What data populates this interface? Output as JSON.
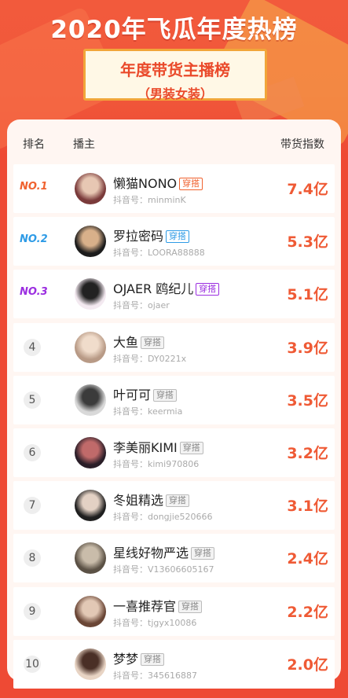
{
  "hero": {
    "title": "2020年飞瓜年度热榜",
    "badge_title": "年度带货主播榜",
    "badge_sub": "（男装女装）"
  },
  "table": {
    "headers": {
      "rank": "排名",
      "host": "播主",
      "index": "带货指数"
    },
    "rows": [
      {
        "rank": "NO.1",
        "name": "懒猫NONO",
        "tag": "穿搭",
        "id_label": "抖音号：",
        "id": "minminK",
        "value": "7.4亿",
        "rank_color": "#f0622f",
        "tag_color": "#f0622f",
        "avatar_colors": [
          "#7a3a3a",
          "#e7c7b3"
        ]
      },
      {
        "rank": "NO.2",
        "name": "罗拉密码",
        "tag": "穿搭",
        "id_label": "抖音号：",
        "id": "LOORA88888",
        "value": "5.3亿",
        "rank_color": "#2e9be6",
        "tag_color": "#2e9be6",
        "avatar_colors": [
          "#1c1c1c",
          "#d8b08a"
        ]
      },
      {
        "rank": "NO.3",
        "name": "OJAER 鸥纪儿",
        "tag": "穿搭",
        "id_label": "抖音号：",
        "id": "ojaer",
        "value": "5.1亿",
        "rank_color": "#9b2ee0",
        "tag_color": "#9b2ee0",
        "avatar_colors": [
          "#f3e9f0",
          "#222222"
        ]
      },
      {
        "rank": "4",
        "name": "大鱼",
        "tag": "穿搭",
        "id_label": "抖音号：",
        "id": "DY0221x",
        "value": "3.9亿",
        "avatar_colors": [
          "#b89a86",
          "#f0dccb"
        ]
      },
      {
        "rank": "5",
        "name": "叶可可",
        "tag": "穿搭",
        "id_label": "抖音号：",
        "id": "keermia",
        "value": "3.5亿",
        "avatar_colors": [
          "#d9d9d9",
          "#3b3b3b"
        ]
      },
      {
        "rank": "6",
        "name": "李美丽KIMI",
        "tag": "穿搭",
        "id_label": "抖音号：",
        "id": "kimi970806",
        "value": "3.2亿",
        "avatar_colors": [
          "#2a1e28",
          "#c06a6a"
        ]
      },
      {
        "rank": "7",
        "name": "冬姐精选",
        "tag": "穿搭",
        "id_label": "抖音号：",
        "id": "dongjie520666",
        "value": "3.1亿",
        "avatar_colors": [
          "#1f1f1f",
          "#e3d1c4"
        ]
      },
      {
        "rank": "8",
        "name": "星线好物严选",
        "tag": "穿搭",
        "id_label": "抖音号：",
        "id": "V13606605167",
        "value": "2.4亿",
        "avatar_colors": [
          "#5b5145",
          "#c9bcaa"
        ]
      },
      {
        "rank": "9",
        "name": "一喜推荐官",
        "tag": "穿搭",
        "id_label": "抖音号：",
        "id": "tjgyx10086",
        "value": "2.2亿",
        "avatar_colors": [
          "#6a4636",
          "#e2c8b5"
        ]
      },
      {
        "rank": "10",
        "name": "梦梦",
        "tag": "穿搭",
        "id_label": "抖音号：",
        "id": "345616887",
        "value": "2.0亿",
        "avatar_colors": [
          "#e8d4c4",
          "#4a2f26"
        ]
      }
    ]
  }
}
